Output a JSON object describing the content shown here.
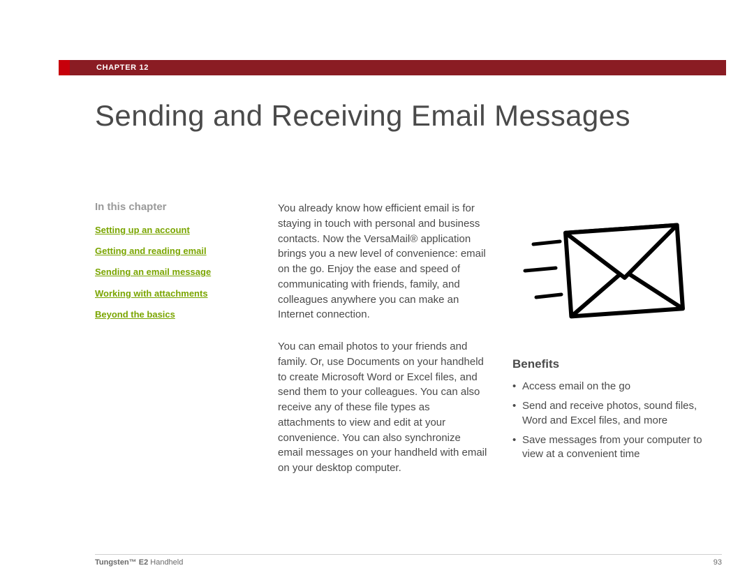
{
  "chapter": {
    "label": "CHAPTER 12"
  },
  "title": "Sending and Receiving Email Messages",
  "sidebar": {
    "heading": "In this chapter",
    "links": [
      "Setting up an account",
      "Getting and reading email",
      "Sending an email message",
      "Working with attachments",
      "Beyond the basics"
    ]
  },
  "body": {
    "p1": "You already know how efficient email is for staying in touch with personal and business contacts. Now the VersaMail® application brings you a new level of convenience: email on the go. Enjoy the ease and speed of communicating with friends, family, and colleagues anywhere you can make an Internet connection.",
    "p2": "You can email photos to your friends and family. Or, use Documents on your handheld to create Microsoft Word or Excel files, and send them to your colleagues. You can also receive any of these file types as attachments to view and edit at your convenience. You can also synchronize email messages on your handheld with email on your desktop computer."
  },
  "benefits": {
    "heading": "Benefits",
    "items": [
      "Access email on the go",
      "Send and receive photos, sound files, Word and Excel files, and more",
      "Save messages from your computer to view at a convenient time"
    ]
  },
  "footer": {
    "product_bold": "Tungsten™ E2",
    "product_rest": " Handheld",
    "page": "93"
  },
  "icons": {
    "envelope": "envelope-icon"
  }
}
